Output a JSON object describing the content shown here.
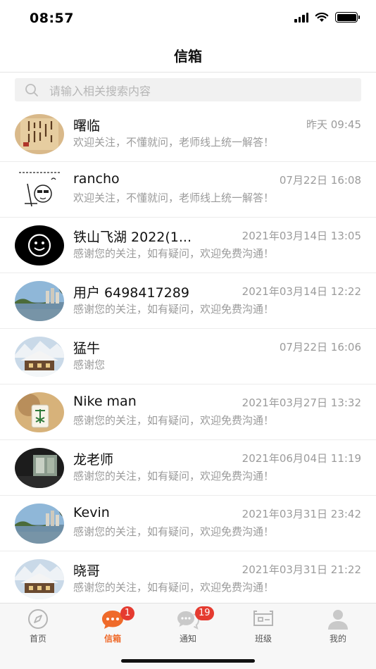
{
  "status_bar": {
    "time": "08:57",
    "icons": [
      "signal-icon",
      "wifi-icon",
      "battery-icon"
    ]
  },
  "nav": {
    "title": "信箱"
  },
  "search": {
    "placeholder": "请输入相关搜索内容",
    "icon": "search-icon"
  },
  "messages": [
    {
      "name": "曙临",
      "time": "昨天 09:45",
      "preview": "欢迎关注，不懂就问，老师线上统一解答！",
      "avatar": "calligraphy-avatar"
    },
    {
      "name": "rancho",
      "time": "07月22日 16:08",
      "preview": "欢迎关注，不懂就问，老师线上统一解答！",
      "avatar": "cartoon-sketch-avatar"
    },
    {
      "name": "铁山飞湖 2022(1...",
      "time": "2021年03月14日 13:05",
      "preview": "感谢您的关注，如有疑问，欢迎免费沟通！",
      "avatar": "smiley-avatar"
    },
    {
      "name": "用户 6498417289",
      "time": "2021年03月14日 12:22",
      "preview": "感谢您的关注，如有疑问，欢迎免费沟通！",
      "avatar": "lake-landscape-avatar"
    },
    {
      "name": "猛牛",
      "time": "07月22日 16:06",
      "preview": "感谢您",
      "avatar": "snow-chalet-avatar"
    },
    {
      "name": "Nike man",
      "time": "2021年03月27日 13:32",
      "preview": "感谢您的关注，如有疑问，欢迎免费沟通！",
      "avatar": "mahjong-tile-avatar"
    },
    {
      "name": "龙老师",
      "time": "2021年06月04日 11:19",
      "preview": "感谢您的关注，如有疑问，欢迎免费沟通！",
      "avatar": "dark-window-avatar"
    },
    {
      "name": "Kevin",
      "time": "2021年03月31日 23:42",
      "preview": "感谢您的关注，如有疑问，欢迎免费沟通！",
      "avatar": "lake-landscape-avatar"
    },
    {
      "name": "晓哥",
      "time": "2021年03月31日 21:22",
      "preview": "感谢您的关注，如有疑问，欢迎免费沟通！",
      "avatar": "snow-chalet-avatar"
    }
  ],
  "tabs": [
    {
      "label": "首页",
      "icon": "compass-icon",
      "badge": ""
    },
    {
      "label": "信箱",
      "icon": "chat-bubble-icon",
      "badge": "1",
      "active": true
    },
    {
      "label": "通知",
      "icon": "notification-bubble-icon",
      "badge": "19"
    },
    {
      "label": "班级",
      "icon": "class-board-icon",
      "badge": ""
    },
    {
      "label": "我的",
      "icon": "user-icon",
      "badge": ""
    }
  ],
  "colors": {
    "accent": "#ef6a2a",
    "badge": "#e53b30",
    "muted_text": "#9b9b9b"
  }
}
